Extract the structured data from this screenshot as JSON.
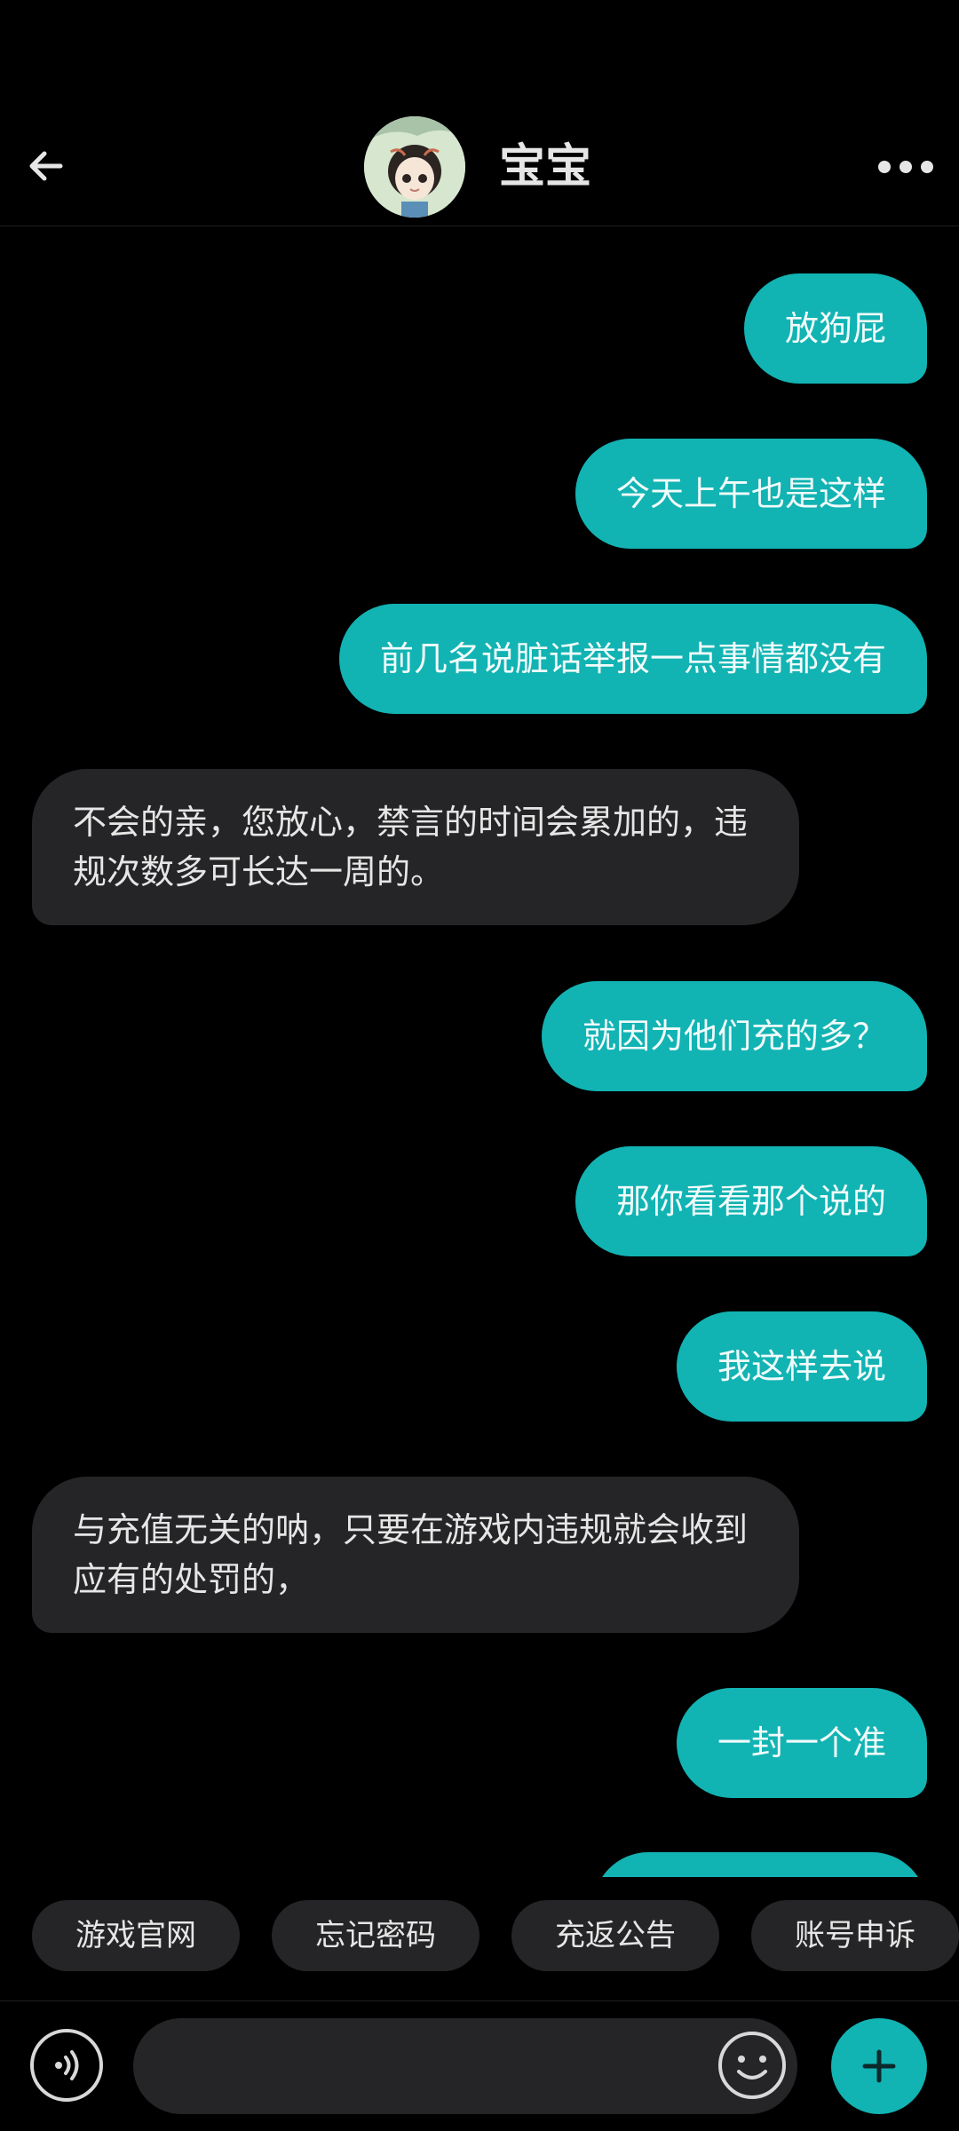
{
  "header": {
    "title": "宝宝",
    "back_icon": "arrow-left-icon",
    "more_icon": "more-horizontal-icon"
  },
  "messages": [
    {
      "side": "me",
      "text": "放狗屁"
    },
    {
      "side": "me",
      "text": "今天上午也是这样"
    },
    {
      "side": "me",
      "text": "前几名说脏话举报一点事情都没有"
    },
    {
      "side": "them",
      "text": "不会的亲，您放心，禁言的时间会累加的，违规次数多可长达一周的。"
    },
    {
      "side": "me",
      "text": "就因为他们充的多？"
    },
    {
      "side": "me",
      "text": "那你看看那个说的"
    },
    {
      "side": "me",
      "text": "我这样去说"
    },
    {
      "side": "them",
      "text": "与充值无关的呐，只要在游戏内违规就会收到应有的处罚的，"
    },
    {
      "side": "me",
      "text": "一封一个准"
    }
  ],
  "quick_replies": [
    "游戏官网",
    "忘记密码",
    "充返公告",
    "账号申诉"
  ],
  "composer": {
    "voice_icon": "voice-icon",
    "emoji_icon": "emoji-icon",
    "plus_icon": "plus-icon"
  },
  "colors": {
    "accent": "#12b3b3",
    "background": "#000000",
    "incoming_bubble": "#252527",
    "text": "#e6e6e6"
  }
}
